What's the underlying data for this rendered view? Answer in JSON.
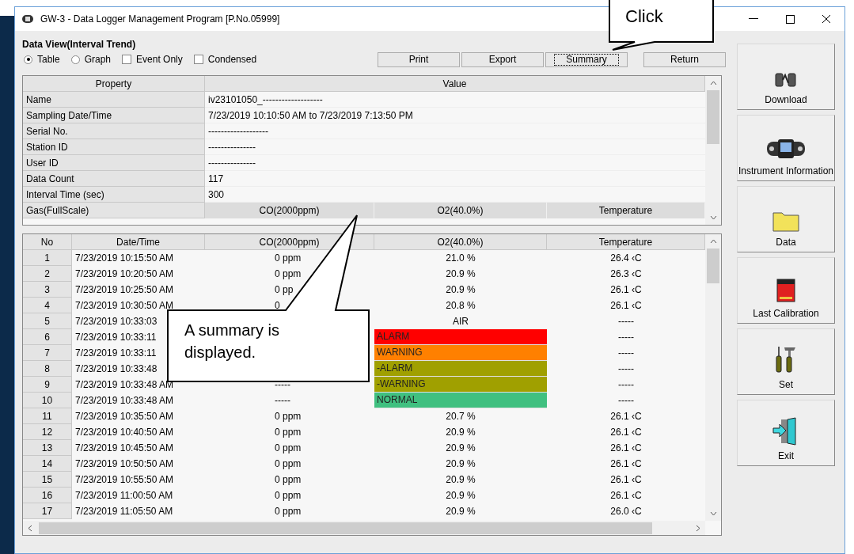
{
  "window": {
    "title": "GW-3 - Data Logger Management Program [P.No.05999]"
  },
  "group_title": "Data View(Interval Trend)",
  "view_options": [
    {
      "kind": "radio",
      "label": "Table",
      "selected": true
    },
    {
      "kind": "radio",
      "label": "Graph",
      "selected": false
    },
    {
      "kind": "checkbox",
      "label": "Event Only",
      "checked": false
    },
    {
      "kind": "checkbox",
      "label": "Condensed",
      "checked": false
    }
  ],
  "buttons": [
    {
      "label": "Print",
      "focused": false
    },
    {
      "label": "Export",
      "focused": false
    },
    {
      "label": "Summary",
      "focused": true
    },
    {
      "label": "Return",
      "focused": false
    }
  ],
  "property_table": {
    "columns": [
      "Property",
      "Value"
    ],
    "rows": [
      {
        "property": "Name",
        "value": "iv23101050_-------------------"
      },
      {
        "property": "Sampling Date/Time",
        "value": "7/23/2019 10:10:50 AM to 7/23/2019 7:13:50 PM"
      },
      {
        "property": "Serial No.",
        "value": "-------------------"
      },
      {
        "property": "Station ID",
        "value": "---------------"
      },
      {
        "property": "User ID",
        "value": "---------------"
      },
      {
        "property": "Data Count",
        "value": "117"
      },
      {
        "property": "Interval Time (sec)",
        "value": "300"
      },
      {
        "property": "Gas(FullScale)",
        "gases": [
          "CO(2000ppm)",
          "O2(40.0%)",
          "Temperature"
        ]
      }
    ]
  },
  "data_table": {
    "columns": [
      "No",
      "Date/Time",
      "CO(2000ppm)",
      "O2(40.0%)",
      "Temperature"
    ],
    "rows": [
      {
        "no": "1",
        "datetime": "7/23/2019 10:15:50 AM",
        "co": "0 ppm",
        "o2": "21.0 %",
        "temp": "26.4 ‹C"
      },
      {
        "no": "2",
        "datetime": "7/23/2019 10:20:50 AM",
        "co": "0 ppm",
        "o2": "20.9 %",
        "temp": "26.3 ‹C"
      },
      {
        "no": "3",
        "datetime": "7/23/2019 10:25:50 AM",
        "co": "0 pp",
        "o2": "20.9 %",
        "temp": "26.1 ‹C"
      },
      {
        "no": "4",
        "datetime": "7/23/2019 10:30:50 AM",
        "co": "0",
        "o2": "20.8 %",
        "temp": "26.1 ‹C"
      },
      {
        "no": "5",
        "datetime": "7/23/2019 10:33:03",
        "o2": "AIR",
        "temp": "-----"
      },
      {
        "no": "6",
        "datetime": "7/23/2019 10:33:11",
        "o2": "ALARM",
        "color": "#ff0000",
        "temp": "-----"
      },
      {
        "no": "7",
        "datetime": "7/23/2019 10:33:11",
        "o2": "WARNING",
        "color": "#ff8000",
        "temp": "-----"
      },
      {
        "no": "8",
        "datetime": "7/23/2019 10:33:48",
        "o2": "-ALARM",
        "color": "#a0a000",
        "temp": "-----"
      },
      {
        "no": "9",
        "datetime": "7/23/2019 10:33:48 AM",
        "co": "-----",
        "o2": "-WARNING",
        "color": "#a0a000",
        "temp": "-----"
      },
      {
        "no": "10",
        "datetime": "7/23/2019 10:33:48 AM",
        "co": "-----",
        "o2": "NORMAL",
        "color": "#40c080",
        "temp": "-----"
      },
      {
        "no": "11",
        "datetime": "7/23/2019 10:35:50 AM",
        "co": "0 ppm",
        "o2": "20.7 %",
        "temp": "26.1 ‹C"
      },
      {
        "no": "12",
        "datetime": "7/23/2019 10:40:50 AM",
        "co": "0 ppm",
        "o2": "20.9 %",
        "temp": "26.1 ‹C"
      },
      {
        "no": "13",
        "datetime": "7/23/2019 10:45:50 AM",
        "co": "0 ppm",
        "o2": "20.9 %",
        "temp": "26.1 ‹C"
      },
      {
        "no": "14",
        "datetime": "7/23/2019 10:50:50 AM",
        "co": "0 ppm",
        "o2": "20.9 %",
        "temp": "26.1 ‹C"
      },
      {
        "no": "15",
        "datetime": "7/23/2019 10:55:50 AM",
        "co": "0 ppm",
        "o2": "20.9 %",
        "temp": "26.1 ‹C"
      },
      {
        "no": "16",
        "datetime": "7/23/2019 11:00:50 AM",
        "co": "0 ppm",
        "o2": "20.9 %",
        "temp": "26.1 ‹C"
      },
      {
        "no": "17",
        "datetime": "7/23/2019 11:05:50 AM",
        "co": "0 ppm",
        "o2": "20.9 %",
        "temp": "26.0 ‹C"
      }
    ]
  },
  "side_buttons": [
    {
      "kind": "download",
      "label": "Download"
    },
    {
      "kind": "instrument",
      "label": "Instrument Information"
    },
    {
      "kind": "data",
      "label": "Data"
    },
    {
      "kind": "calibration",
      "label": "Last Calibration"
    },
    {
      "kind": "set",
      "label": "Set"
    },
    {
      "kind": "exit",
      "label": "Exit"
    }
  ],
  "callouts": [
    {
      "kind": "click",
      "text": "Click"
    },
    {
      "kind": "summary",
      "text": "A summary is displayed."
    }
  ]
}
